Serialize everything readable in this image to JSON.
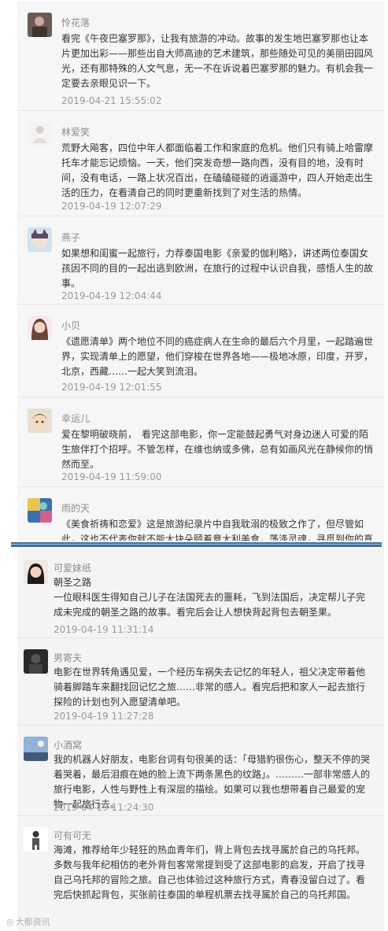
{
  "comments_top": [
    {
      "name": "怜花落",
      "avatar_icon": "avatar-dark-portrait",
      "content": "看完《午夜巴塞罗那》，让我有旅游的冲动。故事的发生地巴塞罗那也让本片更加出彩——那些出自大师高迪的艺术建筑，那些随处可见的美丽田园风光，还有那特殊的人文气息，无一不在诉说着巴塞罗那的魅力。有机会我一定要去亲眼见识一下。",
      "time": "2019-04-21 15:55:02"
    },
    {
      "name": "林爱笑",
      "avatar_icon": "avatar-meditation",
      "content": "荒野大飚客，四位中年人都面临着工作和家庭的危机。他们只有骑上哈雷摩托车才能忘记烦恼。一天，他们突发奇想一路向西，没有目的地，没有时间，没有电话，一路上状况百出，在磕磕碰碰的逍遥游中，四人开始走出生活的压力，在看清自己的同时更重新找到了对生活的热情。",
      "time": "2019-04-19 12:07:29"
    },
    {
      "name": "燕子",
      "avatar_icon": "avatar-anime-cat",
      "content": "如果想和闺蜜一起旅行，力荐泰国电影《亲爱的伽利略》，讲述两位泰国女孩因不同的目的一起出逃到欧洲，在旅行的过程中认识自我，感悟人生的故事。",
      "time": "2019-04-19 12:04:44"
    },
    {
      "name": "小贝",
      "avatar_icon": "avatar-girl",
      "content": "《遗愿清单》两个地位不同的癌症病人在生命的最后六个月里，一起踏遍世界，实现清单上的愿望，他们穿梭在世界各地——极地冰原，印度，开罗，北京，西藏……一起大笑到流泪。",
      "time": "2019-04-19 12:01:55"
    },
    {
      "name": "幸运儿",
      "avatar_icon": "avatar-cartoon-girl",
      "content": "爱在黎明破晓前，　看完这部电影，你一定能鼓起勇气对身边迷人可爱的陌生旅伴打个招呼。不管怎样，在维也纳或多佛，总有如画风光在静候你的悄然而至。",
      "time": "2019-04-19 11:59:00"
    },
    {
      "name": "雨的天",
      "avatar_icon": "avatar-colorful",
      "content": "《美食祈祷和恋爱》这是旅游纪录片中自我耽溺的极致之作了，但尽管如此，这也不代表你就不能大块朵颐着意大利美食，荡涤灵魂，寻觅到你的真爱。",
      "time": ""
    }
  ],
  "comments_bottom": [
    {
      "name": "可爱妹纸",
      "avatar_icon": "avatar-girl-dark-hair",
      "content": "朝圣之路\n一位眼科医生得知自己儿子在法国死去的噩耗，飞到法国后，决定帮儿子完成未完成的朝圣之路的故事。看完后会让人想快背起背包去朝圣果。",
      "time": "2019-04-19 11:31:14"
    },
    {
      "name": "男寄夫",
      "avatar_icon": "avatar-dark-figure",
      "content": "电影在世界转角遇见爱，一个经历车祸失去记忆的年轻人，祖父决定带着他骑着脚踏车来翻找回记忆之旅……非常的感人。看完后把和家人一起去旅行探险的计划也列入愿望清单吧。",
      "time": "2019-04-19 11:27:28"
    },
    {
      "name": "小酒窝",
      "avatar_icon": "avatar-sky-scene",
      "content": "我的机器人好朋友，电影台词有句很美的话：「母猎豹很伤心，整天不停的哭着哭着，最后泪痕在她的脸上流下两条黑色的纹路」。………一部非常感人的旅行电影，人性与野性上有深层的描绘。如果可以我也想带着自己最爱的宠物一起旅行去。",
      "time": "2019-04-19 11:24:30"
    },
    {
      "name": "可有可无",
      "avatar_icon": "avatar-small-figure",
      "content": "海滩，推荐给年少轻狂的热血青年们，背上背包去找寻属於自己的乌托邦。多数与我年纪相仿的老外背包客常常提到受了这部电影的启发，开启了找寻自己乌托邦的冒险之旅。自己也体验过这种旅行方式，青春没留白过了。看完后快抓起背包，买张前往泰国的单程机票去找寻属於自己的乌托邦国。",
      "time": ""
    }
  ],
  "watermark": {
    "icon": "weibo-icon",
    "text": "大都资讯"
  }
}
